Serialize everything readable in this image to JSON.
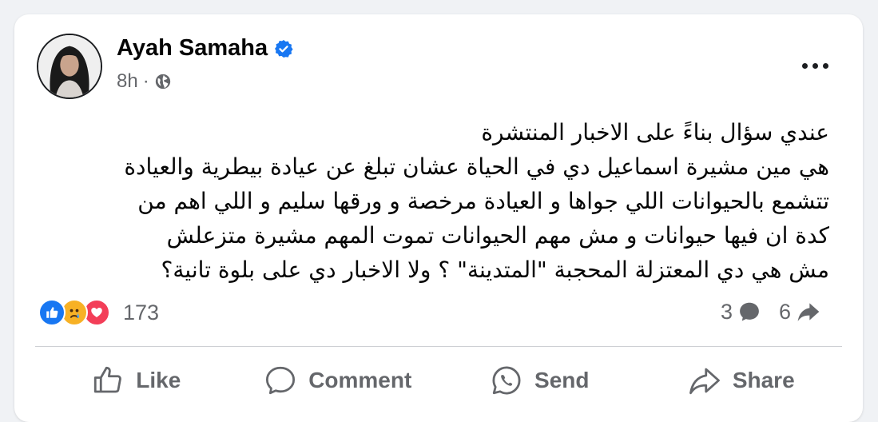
{
  "post": {
    "author": "Ayah Samaha",
    "time": "8h",
    "text_lines": [
      "عندي سؤال بناءً على الاخبار المنتشرة",
      "هي مين مشيرة اسماعيل دي في الحياة عشان تبلغ عن عيادة بيطرية والعيادة",
      "تتشمع بالحيوانات اللي جواها و العيادة مرخصة و ورقها سليم و اللي اهم من",
      "كدة ان فيها حيوانات و مش مهم الحيوانات تموت المهم مشيرة متزعلش",
      "مش هي دي المعتزلة المحجبة \"المتدينة\" ؟ ولا الاخبار دي على بلوة تانية؟"
    ]
  },
  "engagement": {
    "reactions_count": "173",
    "reaction_icons": [
      "like-icon",
      "sad-icon",
      "love-icon"
    ],
    "comments_count": "3",
    "shares_count": "6"
  },
  "actions": {
    "like": "Like",
    "comment": "Comment",
    "send": "Send",
    "share": "Share"
  },
  "colors": {
    "brand_blue": "#1877f2",
    "text_secondary": "#65676b",
    "love_red": "#f33e58",
    "sad_yellow": "#f7b125"
  }
}
